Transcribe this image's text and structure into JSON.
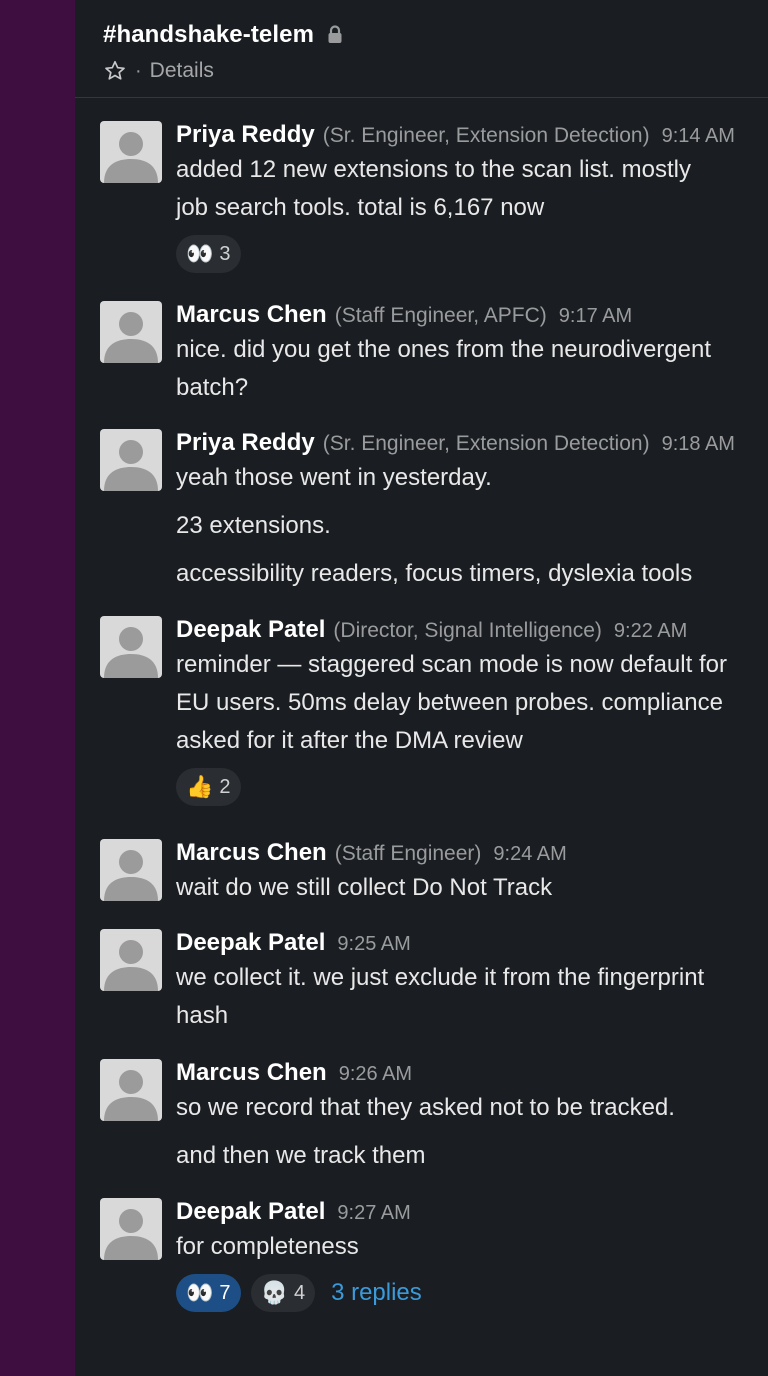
{
  "channel": {
    "name": "#handshake-telem",
    "separator": "·",
    "details_label": "Details"
  },
  "messages": [
    {
      "author": "Priya Reddy",
      "role": "(Sr. Engineer, Extension Detection)",
      "time": "9:14 AM",
      "lines": [
        "added 12 new extensions to the scan list. mostly",
        "job search tools. total is 6,167 now"
      ],
      "reactions": [
        {
          "emoji": "👀",
          "count": "3"
        }
      ]
    },
    {
      "author": "Marcus Chen",
      "role": "(Staff Engineer, APFC)",
      "time": "9:17 AM",
      "lines": [
        "nice. did you get the ones from the neurodivergent",
        "batch?"
      ]
    },
    {
      "author": "Priya Reddy",
      "role": "(Sr. Engineer, Extension Detection)",
      "time": "9:18 AM",
      "lines": [
        "yeah those went in yesterday.",
        "23 extensions.",
        "accessibility readers, focus timers, dyslexia tools"
      ]
    },
    {
      "author": "Deepak Patel",
      "role": "(Director, Signal Intelligence)",
      "time": "9:22 AM",
      "lines": [
        "reminder — staggered scan mode is now default for",
        "EU users. 50ms delay between probes. compliance",
        "asked for it after the DMA review"
      ],
      "reactions": [
        {
          "emoji": "👍",
          "count": "2"
        }
      ]
    },
    {
      "author": "Marcus Chen",
      "role": "(Staff Engineer)",
      "time": "9:24 AM",
      "lines": [
        "wait do we still collect Do Not Track"
      ]
    },
    {
      "author": "Deepak Patel",
      "time": "9:25 AM",
      "lines": [
        "we collect it. we just exclude it from the fingerprint",
        "hash"
      ]
    },
    {
      "author": "Marcus Chen",
      "time": "9:26 AM",
      "lines": [
        "so we record that they asked not to be tracked.",
        "and then we track them"
      ]
    },
    {
      "author": "Deepak Patel",
      "time": "9:27 AM",
      "lines": [
        "for completeness"
      ],
      "reactions": [
        {
          "emoji": "👀",
          "count": "7",
          "active": true
        },
        {
          "emoji": "💀",
          "count": "4"
        }
      ],
      "replies_label": "3 replies"
    }
  ],
  "colors": {
    "sidebar": "#3f0e40",
    "background": "#1a1d21",
    "link": "#3b9ad9",
    "active_reaction": "#1d4f86"
  }
}
